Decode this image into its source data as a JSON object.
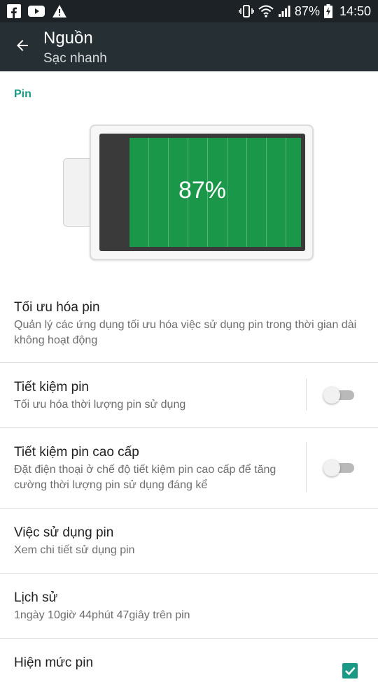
{
  "status_bar": {
    "icons": [
      "facebook-icon",
      "youtube-icon",
      "warning-icon",
      "vibrate-icon",
      "wifi-icon",
      "signal-icon",
      "battery-charging-icon"
    ],
    "battery_percent": "87%",
    "time": "14:50"
  },
  "app_bar": {
    "back_icon": "arrow-back-icon",
    "title": "Nguồn",
    "subtitle": "Sạc nhanh"
  },
  "section": {
    "header": "Pin"
  },
  "battery": {
    "level_percent": 87,
    "label": "87%",
    "fill_color": "#1a9748"
  },
  "prefs": [
    {
      "title": "Tối ưu hóa pin",
      "summary": "Quản lý các ứng dụng tối ưu hóa việc sử dụng pin trong thời gian dài không hoạt động"
    },
    {
      "title": "Tiết kiệm pin",
      "summary": "Tối ưu hóa thời lượng pin sử dụng",
      "switch_on": false
    },
    {
      "title": "Tiết kiệm pin cao cấp",
      "summary": "Đặt điện thoại ở chế độ tiết kiệm pin cao cấp để tăng cường thời lượng pin sử dụng đáng kể",
      "switch_on": false
    },
    {
      "title": "Việc sử dụng pin",
      "summary": "Xem chi tiết sử dụng pin"
    },
    {
      "title": "Lịch sử",
      "summary": "1ngày 10giờ 44phút 47giây trên pin"
    },
    {
      "title": "Hiện mức pin",
      "checked": true
    }
  ],
  "colors": {
    "status_bar": "#1c2226",
    "app_bar": "#262f34",
    "accent": "#1a9a86"
  }
}
